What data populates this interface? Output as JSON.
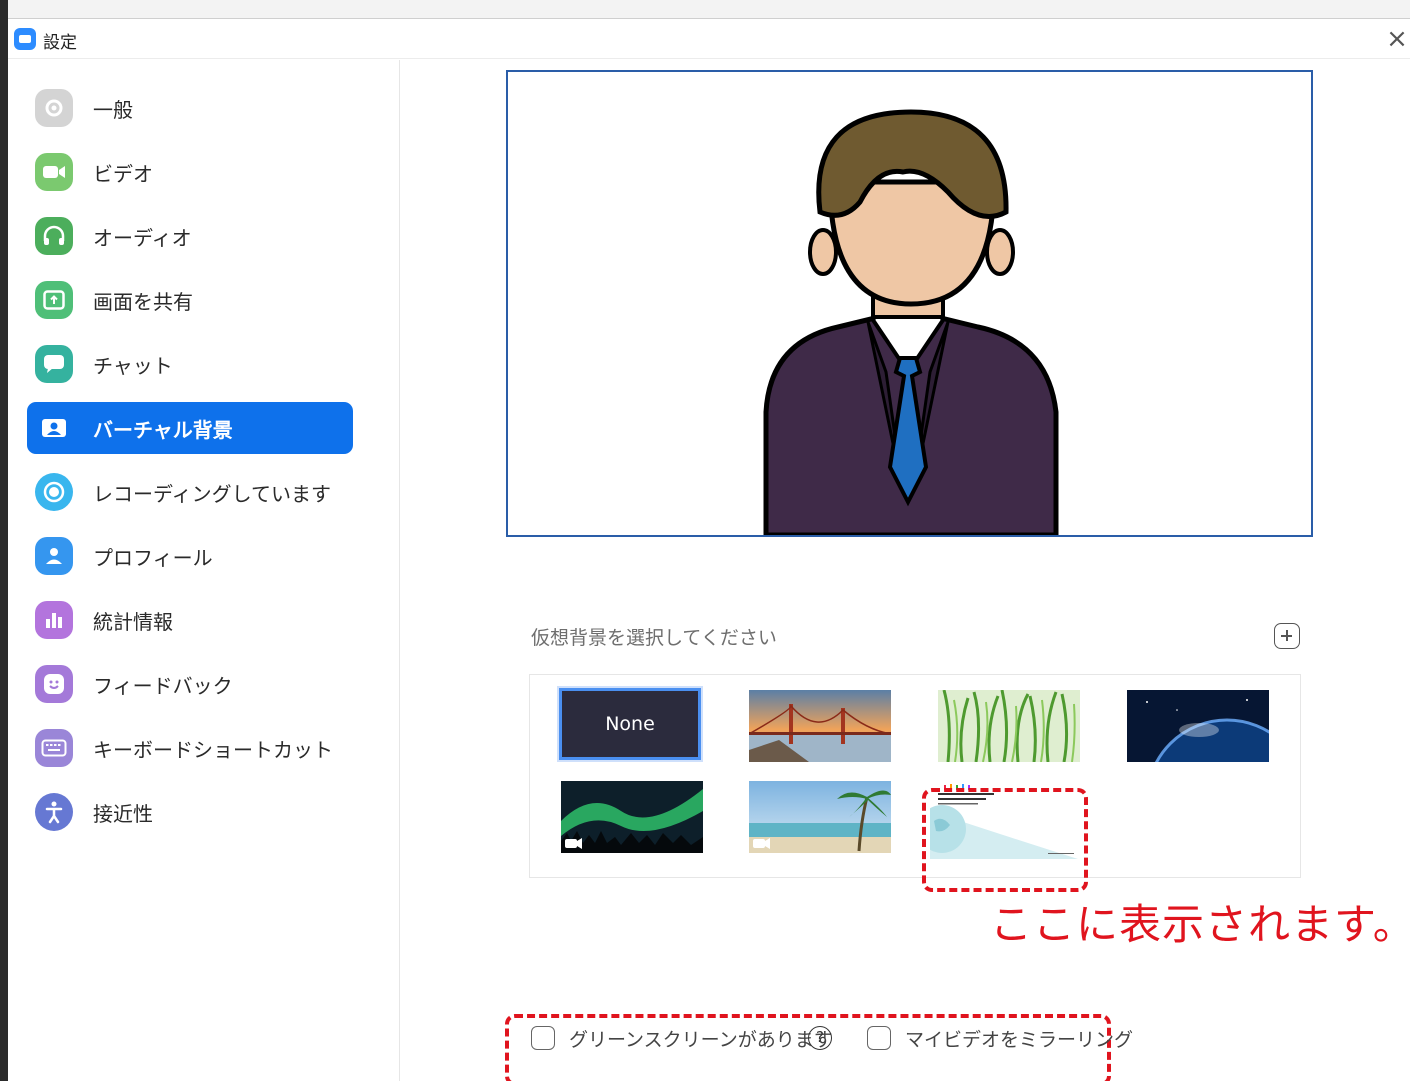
{
  "window": {
    "title": "設定",
    "close_glyph": "×"
  },
  "sidebar": {
    "items": [
      {
        "label": "一般",
        "icon": "gear-icon",
        "color": "#cfcfcf",
        "active": false
      },
      {
        "label": "ビデオ",
        "icon": "video-camera-icon",
        "color": "#7bc96f",
        "active": false
      },
      {
        "label": "オーディオ",
        "icon": "headphones-icon",
        "color": "#5cb85c",
        "active": false
      },
      {
        "label": "画面を共有",
        "icon": "share-screen-icon",
        "color": "#5cbf7a",
        "active": false
      },
      {
        "label": "チャット",
        "icon": "chat-icon",
        "color": "#3cb8a6",
        "active": false
      },
      {
        "label": "バーチャル背景",
        "icon": "virtual-background-icon",
        "color": "#ffffff",
        "active": true
      },
      {
        "label": "レコーディングしています",
        "icon": "recording-icon",
        "color": "#3fb9ef",
        "active": false
      },
      {
        "label": "プロフィール",
        "icon": "profile-icon",
        "color": "#3d9cf0",
        "active": false
      },
      {
        "label": "統計情報",
        "icon": "statistics-icon",
        "color": "#b67bdc",
        "active": false
      },
      {
        "label": "フィードバック",
        "icon": "feedback-icon",
        "color": "#a97ed9",
        "active": false
      },
      {
        "label": "キーボードショートカット",
        "icon": "keyboard-icon",
        "color": "#9b8ad8",
        "active": false
      },
      {
        "label": "接近性",
        "icon": "accessibility-icon",
        "color": "#6d7bd6",
        "active": false
      }
    ]
  },
  "main": {
    "preview_icon": "person-avatar-preview",
    "choose_label": "仮想背景を選択してください",
    "add_icon": "plus-icon",
    "backgrounds": [
      {
        "name": "none",
        "label": "None",
        "selected": true
      },
      {
        "name": "golden-gate-bridge",
        "label": "",
        "selected": false
      },
      {
        "name": "grass",
        "label": "",
        "selected": false
      },
      {
        "name": "earth-from-space",
        "label": "",
        "selected": false
      },
      {
        "name": "aurora",
        "label": "",
        "selected": false,
        "video": true
      },
      {
        "name": "beach",
        "label": "",
        "selected": false,
        "video": true
      },
      {
        "name": "custom-uploaded",
        "label": "",
        "selected": false
      }
    ],
    "callout": "ここに表示されます。",
    "options": {
      "green_screen_label": "グリーンスクリーンがあります",
      "help_glyph": "?",
      "mirror_label": "マイビデオをミラーリング"
    }
  },
  "colors": {
    "accent": "#0e71eb",
    "annotation": "#e0141e",
    "preview_border": "#2a5da8"
  }
}
